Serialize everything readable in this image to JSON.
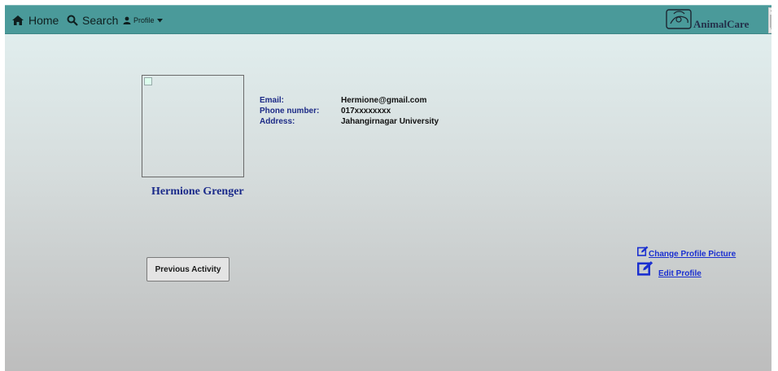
{
  "navbar": {
    "home_label": "Home",
    "search_label": "Search",
    "profile_label": "Profile",
    "logo_text": "AnimalCare"
  },
  "profile": {
    "name": "Hermione Grenger",
    "info": [
      {
        "label": "Email:",
        "value": "Hermione@gmail.com"
      },
      {
        "label": "Phone number:",
        "value": "017xxxxxxxx"
      },
      {
        "label": "Address:",
        "value": "Jahangirnagar University"
      }
    ]
  },
  "actions": {
    "previous_activity_label": "Previous Activity",
    "change_picture_label": "Change Profile Picture",
    "edit_profile_label": "Edit Profile"
  },
  "colors": {
    "navbar": "#4a9a9a",
    "link": "#1a2fd0",
    "name": "#1a2a8a"
  }
}
